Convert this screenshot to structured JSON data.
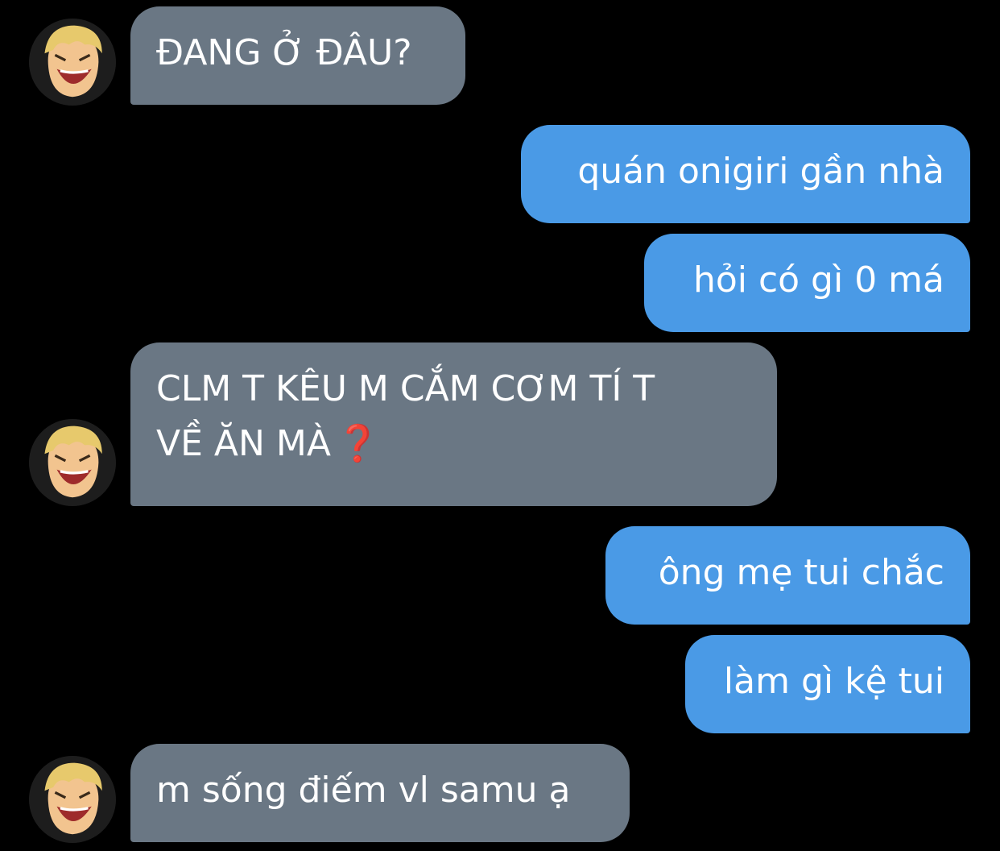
{
  "messages": [
    {
      "side": "in",
      "text": "ĐANG Ở ĐÂU?"
    },
    {
      "side": "out",
      "text": "quán onigiri gần nhà"
    },
    {
      "side": "out",
      "text": "hỏi có gì 0 má"
    },
    {
      "side": "in",
      "line1": "CLM T KÊU M CẮM CƠM TÍ T",
      "line2": "VỀ ĂN MÀ",
      "emoji": "❓"
    },
    {
      "side": "out",
      "text": "ông mẹ tui chắc"
    },
    {
      "side": "out",
      "text": "làm gì kệ tui"
    },
    {
      "side": "in",
      "text": "m sống điếm vl samu ạ"
    }
  ],
  "icons": {
    "avatar": "anime-laughing-blond-avatar",
    "emoji": "red-question-mark"
  },
  "colors": {
    "background": "#000000",
    "incoming": "#6a7784",
    "outgoing": "#4a9ae6",
    "text": "#ffffff"
  }
}
